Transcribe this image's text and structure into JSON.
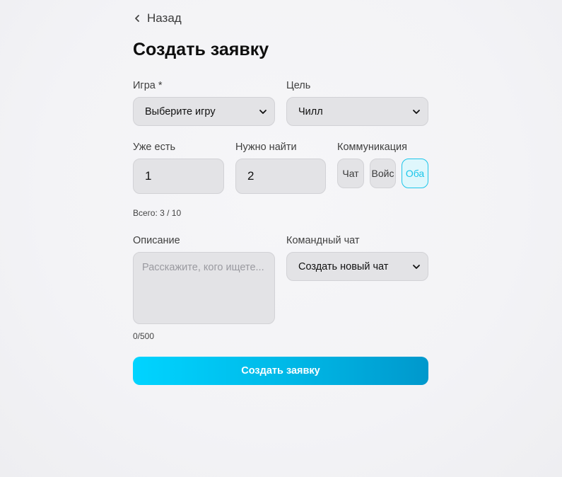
{
  "nav": {
    "back_label": "Назад"
  },
  "page": {
    "title": "Создать заявку"
  },
  "form": {
    "game": {
      "label": "Игра *",
      "value": "Выберите игру"
    },
    "goal": {
      "label": "Цель",
      "value": "Чилл"
    },
    "have": {
      "label": "Уже есть",
      "value": "1"
    },
    "need": {
      "label": "Нужно найти",
      "value": "2"
    },
    "communication": {
      "label": "Коммуникация",
      "options": [
        "Чат",
        "Войс",
        "Оба"
      ],
      "selected": "Оба"
    },
    "total": "Всего: 3 / 10",
    "description": {
      "label": "Описание",
      "placeholder": "Расскажите, кого ищете...",
      "counter": "0/500"
    },
    "team_chat": {
      "label": "Командный чат",
      "value": "Создать новый чат"
    },
    "submit_label": "Создать заявку"
  },
  "colors": {
    "accent": "#1cc6ea",
    "button_start": "#00d4ff",
    "button_end": "#0098cc"
  }
}
